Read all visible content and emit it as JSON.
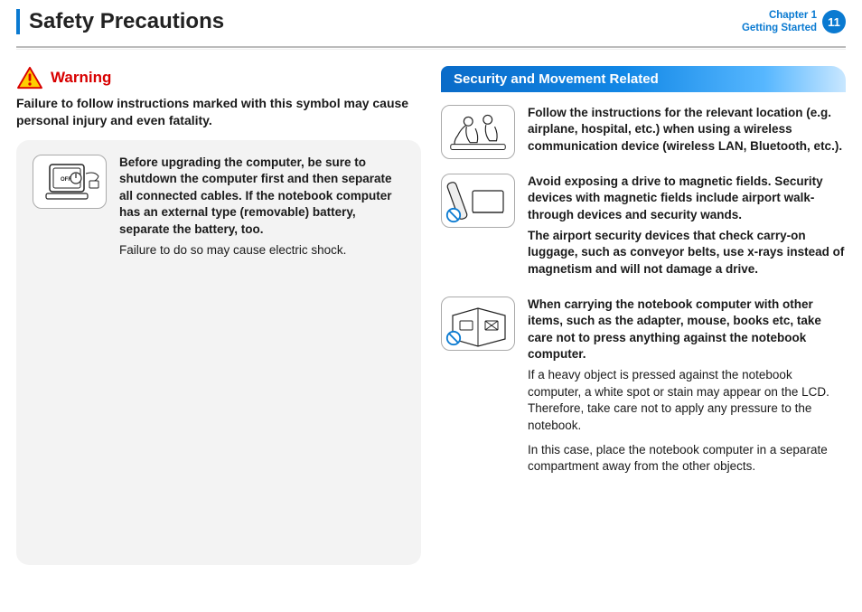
{
  "header": {
    "title": "Safety Precautions",
    "chapter_line1": "Chapter 1",
    "chapter_line2": "Getting Started",
    "page_number": "11"
  },
  "left": {
    "warning_label": "Warning",
    "warning_text": "Failure to follow instructions marked with this symbol may cause personal injury and even fatality.",
    "icon_off_label": "OFF",
    "item1_bold": "Before upgrading the computer, be sure to shutdown the computer first and then separate all connected cables. If the notebook computer has an external type (removable) battery, separate the battery, too.",
    "item1_plain": "Failure to do so may cause electric shock."
  },
  "right": {
    "section_title": "Security and Movement Related",
    "items": [
      {
        "icon": "airplane-seat-icon",
        "bold": "Follow the instructions for the relevant location (e.g. airplane, hospital, etc.) when using a wireless communication device (wireless LAN, Bluetooth, etc.).",
        "plain": []
      },
      {
        "icon": "magnet-wand-icon",
        "bold": "Avoid exposing a drive to magnetic fields. Security devices with magnetic fields include airport walk-through devices and security wands.",
        "bold2": "The airport security devices that check carry-on luggage, such as conveyor belts, use x-rays instead of magnetism and will not damage a drive.",
        "plain": []
      },
      {
        "icon": "bag-pressure-icon",
        "bold": "When carrying the notebook computer with other items, such as the adapter, mouse, books etc, take care not to press anything against the notebook computer.",
        "plain": [
          "If a heavy object is pressed against the notebook computer, a white spot or stain may appear on the LCD. Therefore, take care not to apply any pressure to the notebook.",
          "In this case, place the notebook computer in a separate compartment away from the other objects."
        ]
      }
    ]
  }
}
